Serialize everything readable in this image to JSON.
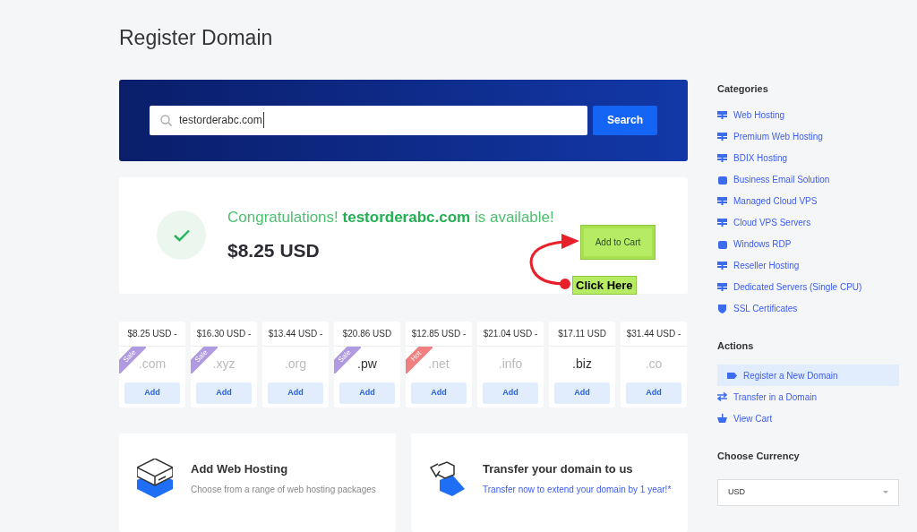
{
  "page_title": "Register Domain",
  "search": {
    "value": "testorderabc.com",
    "button": "Search"
  },
  "result": {
    "message": "Congratulations! **testorderabc.com** is available!",
    "price": "$8.25 USD",
    "button": "Add to Cart",
    "annotation": "Click Here"
  },
  "tlds": [
    {
      "price": "$8.25 USD -",
      "tld": ".com",
      "muted": true,
      "badge": {
        "kind": "sale",
        "label": "Sale"
      },
      "button": "Add"
    },
    {
      "price": "$16.30 USD -",
      "tld": ".xyz",
      "muted": true,
      "badge": {
        "kind": "sale",
        "label": "Sale"
      },
      "button": "Add"
    },
    {
      "price": "$13.44 USD -",
      "tld": ".org",
      "muted": true,
      "button": "Add"
    },
    {
      "price": "$20.86 USD",
      "tld": ".pw",
      "muted": false,
      "badge": {
        "kind": "sale",
        "label": "Sale"
      },
      "button": "Add"
    },
    {
      "price": "$12.85 USD -",
      "tld": ".net",
      "muted": true,
      "badge": {
        "kind": "hot",
        "label": "Hot"
      },
      "button": "Add"
    },
    {
      "price": "$21.04 USD -",
      "tld": ".info",
      "muted": true,
      "button": "Add"
    },
    {
      "price": "$17.11 USD",
      "tld": ".biz",
      "muted": false,
      "button": "Add"
    },
    {
      "price": "$31.44 USD -",
      "tld": ".co",
      "muted": true,
      "button": "Add"
    }
  ],
  "promos": [
    {
      "kind": "hosting",
      "title": "Add Web Hosting",
      "text": "Choose from a range of web hosting packages"
    },
    {
      "kind": "transfer",
      "title": "Transfer your domain to us",
      "text": "Transfer now to extend your domain by 1 year!*"
    }
  ],
  "sidebar": {
    "categories_title": "Categories",
    "categories": [
      {
        "label": "Web Hosting",
        "kind": "server"
      },
      {
        "label": "Premium Web Hosting",
        "kind": "server"
      },
      {
        "label": "BDIX Hosting",
        "kind": "server"
      },
      {
        "label": "Business Email Solution",
        "kind": "box"
      },
      {
        "label": "Managed Cloud VPS",
        "kind": "server"
      },
      {
        "label": "Cloud VPS Servers",
        "kind": "server"
      },
      {
        "label": "Windows RDP",
        "kind": "box"
      },
      {
        "label": "Reseller Hosting",
        "kind": "server"
      },
      {
        "label": "Dedicated Servers (Single CPU)",
        "kind": "server"
      },
      {
        "label": "SSL Certificates",
        "kind": "shield"
      }
    ],
    "actions_title": "Actions",
    "actions": [
      {
        "label": "Register a New Domain",
        "kind": "tag",
        "selected": true
      },
      {
        "label": "Transfer in a Domain",
        "kind": "transfer",
        "selected": false
      },
      {
        "label": "View Cart",
        "kind": "cart",
        "selected": false
      }
    ],
    "currency_title": "Choose Currency",
    "currency": "USD"
  }
}
